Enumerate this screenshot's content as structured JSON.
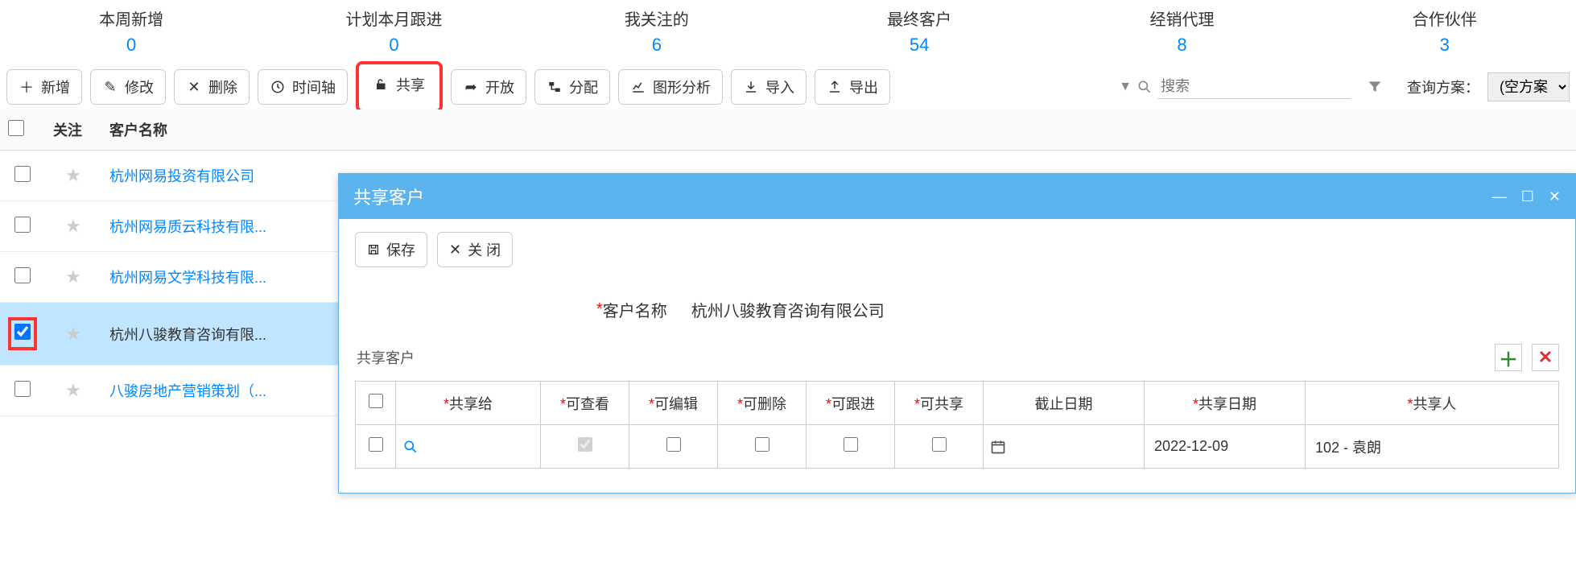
{
  "stats": [
    {
      "label": "本周新增",
      "value": "0"
    },
    {
      "label": "计划本月跟进",
      "value": "0"
    },
    {
      "label": "我关注的",
      "value": "6"
    },
    {
      "label": "最终客户",
      "value": "54"
    },
    {
      "label": "经销代理",
      "value": "8"
    },
    {
      "label": "合作伙伴",
      "value": "3"
    }
  ],
  "toolbar": {
    "add": "新增",
    "edit": "修改",
    "delete": "删除",
    "timeline": "时间轴",
    "share": "共享",
    "open": "开放",
    "assign": "分配",
    "chart": "图形分析",
    "import": "导入",
    "export": "导出",
    "search_placeholder": "搜索",
    "filter_label": "查询方案：",
    "filter_value": "(空方案"
  },
  "list": {
    "col_attention": "关注",
    "col_name": "客户名称",
    "rows": [
      {
        "checked": false,
        "name": "杭州网易投资有限公司"
      },
      {
        "checked": false,
        "name": "杭州网易质云科技有限..."
      },
      {
        "checked": false,
        "name": "杭州网易文学科技有限..."
      },
      {
        "checked": true,
        "name": "杭州八骏教育咨询有限..."
      },
      {
        "checked": false,
        "name": "八骏房地产营销策划（..."
      }
    ]
  },
  "modal": {
    "title": "共享客户",
    "save": "保存",
    "close": "关 闭",
    "customer_label": "客户名称",
    "customer_value": "杭州八骏教育咨询有限公司",
    "section": "共享客户",
    "cols": {
      "share_to": "共享给",
      "view": "可查看",
      "edit": "可编辑",
      "delete": "可删除",
      "follow": "可跟进",
      "reshare": "可共享",
      "due_date": "截止日期",
      "share_date": "共享日期",
      "sharer": "共享人"
    },
    "row": {
      "share_date": "2022-12-09",
      "sharer": "102 - 袁朗"
    }
  }
}
